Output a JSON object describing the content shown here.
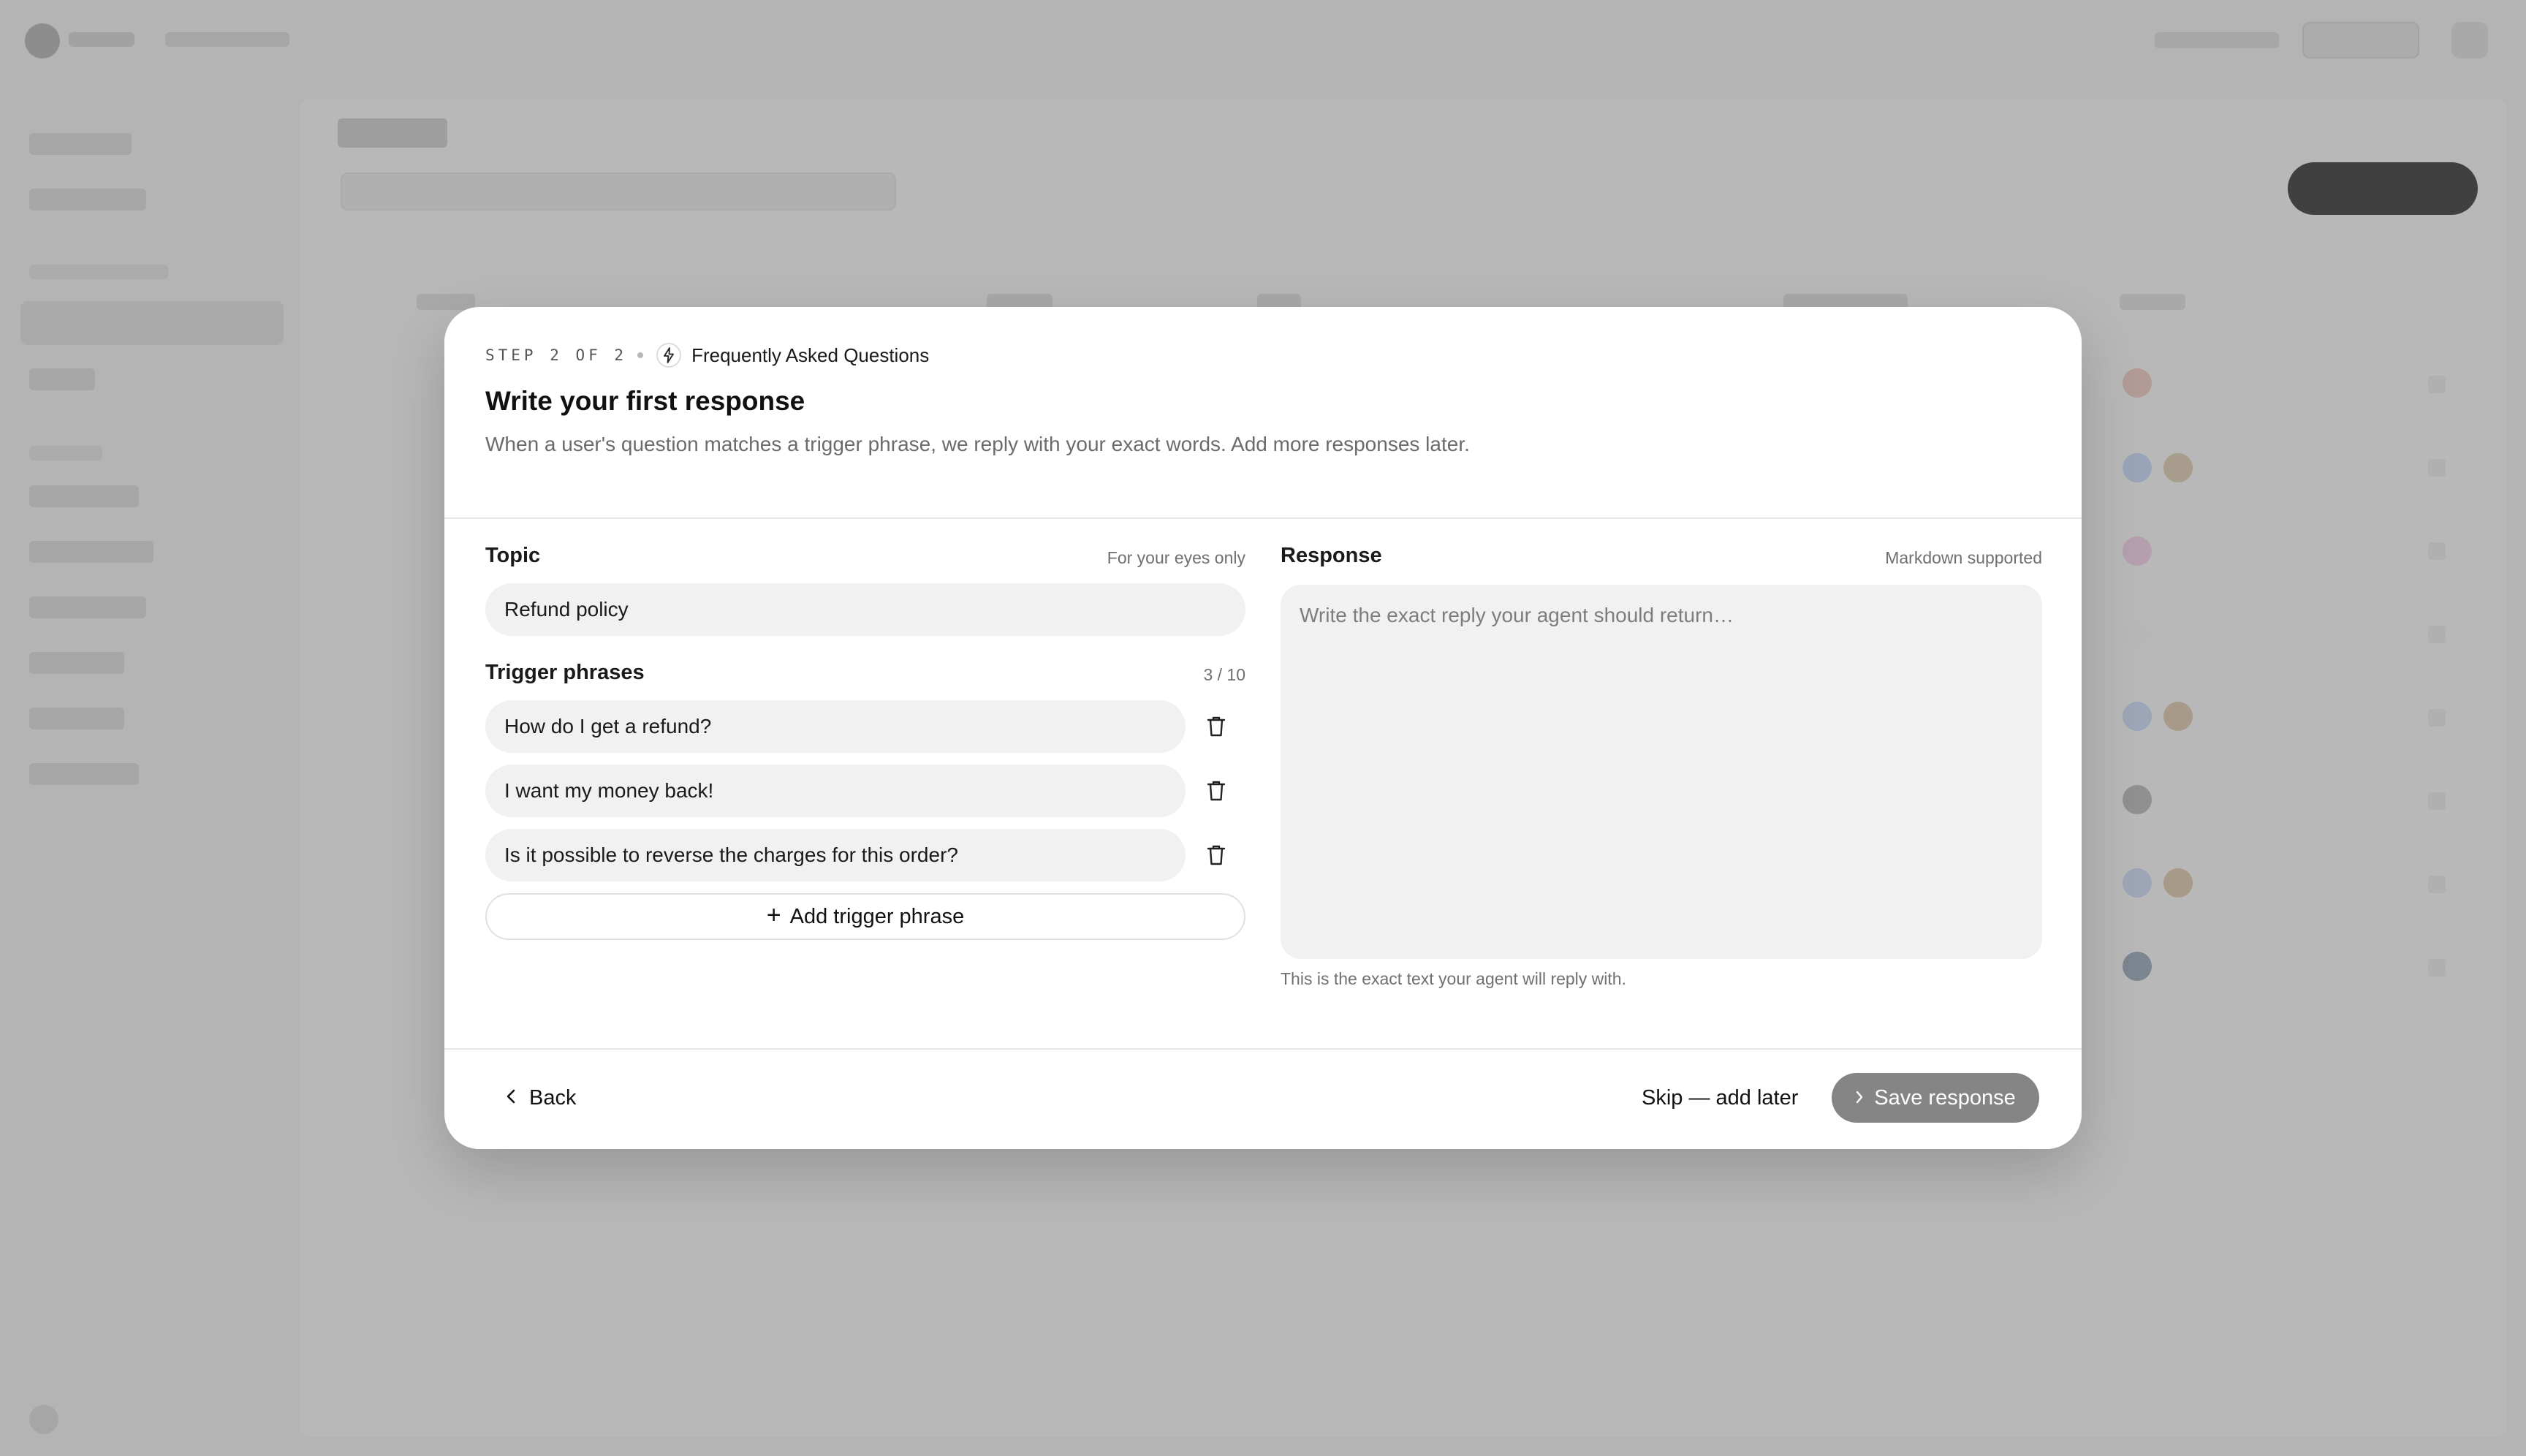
{
  "modal": {
    "step_label": "STEP 2 OF 2",
    "section_name": "Frequently Asked Questions",
    "title": "Write your first response",
    "description": "When a user's question matches a trigger phrase, we reply with your exact words. Add more responses later.",
    "topic": {
      "label": "Topic",
      "hint": "For your eyes only",
      "value": "Refund policy"
    },
    "triggers": {
      "label": "Trigger phrases",
      "count": "3 / 10",
      "items": [
        "How do I get a refund?",
        "I want my money back!",
        "Is it possible to reverse the charges for this order?"
      ],
      "add_label": "Add trigger phrase"
    },
    "response": {
      "label": "Response",
      "hint": "Markdown supported",
      "placeholder": "Write the exact reply your agent should return…",
      "help": "This is the exact text your agent will reply with."
    },
    "footer": {
      "back_label": "Back",
      "skip_label": "Skip — add later",
      "save_label": "Save response"
    }
  },
  "colors": {
    "overlay": "#b4b4b4",
    "modal_bg": "#ffffff",
    "field_bg": "#f1f1f1",
    "primary_disabled": "#858585",
    "text": "#111111",
    "muted": "#6b6b6b"
  },
  "icons": {
    "section": "bolt-icon",
    "trash": "trash-icon",
    "add": "plus-icon",
    "back": "chevron-left-icon",
    "save": "chevron-right-icon"
  }
}
